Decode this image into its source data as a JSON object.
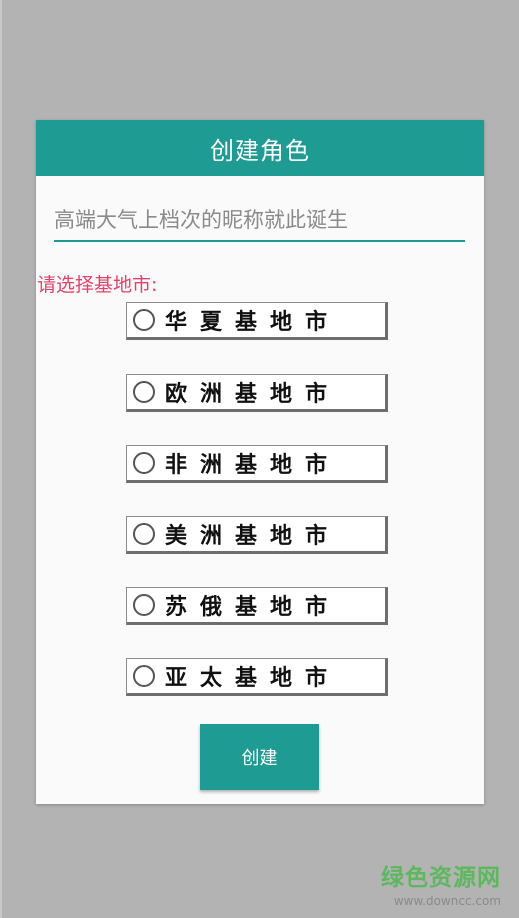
{
  "dialog": {
    "title": "创建角色",
    "nickname": {
      "placeholder": "高端大气上档次的昵称就此诞生",
      "value": ""
    },
    "base_prompt": "请选择基地市:",
    "options": [
      {
        "label": "华夏基地市",
        "selected": false
      },
      {
        "label": "欧洲基地市",
        "selected": false
      },
      {
        "label": "非洲基地市",
        "selected": false
      },
      {
        "label": "美洲基地市",
        "selected": false
      },
      {
        "label": "苏俄基地市",
        "selected": false
      },
      {
        "label": "亚太基地市",
        "selected": false
      }
    ],
    "create_button": "创建"
  },
  "watermark": {
    "title": "绿色资源网",
    "url": "www.downcc.com"
  },
  "colors": {
    "accent": "#1e9b93",
    "prompt": "#e4426a",
    "background": "#b3b3b3",
    "watermark": "#5cb85c"
  }
}
